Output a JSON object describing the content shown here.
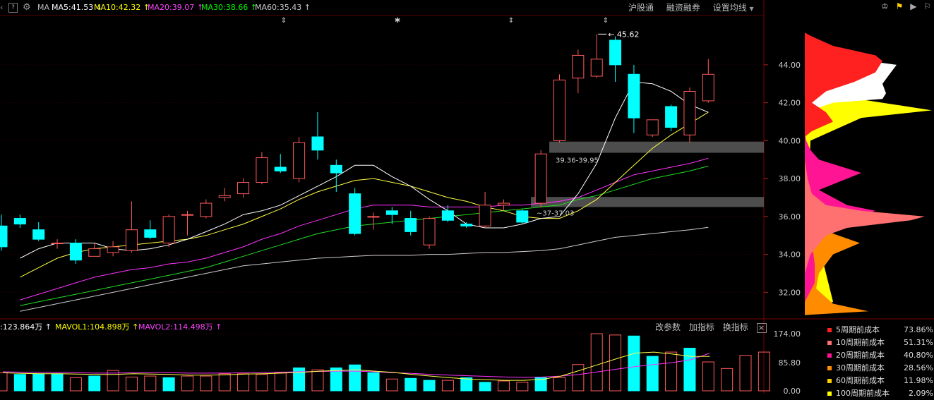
{
  "header": {
    "indicator": "MA",
    "ma": [
      {
        "label": "MA5:41.53",
        "arrow": "↓",
        "color": "#ffffff"
      },
      {
        "label": "MA10:42.32",
        "arrow": "↑",
        "color": "#ffff00"
      },
      {
        "label": "MA20:39.07",
        "arrow": "↑",
        "color": "#ff44ff"
      },
      {
        "label": "MA30:38.66",
        "arrow": "↑",
        "color": "#00ff00"
      },
      {
        "label": "MA60:35.43",
        "arrow": "↑",
        "color": "#cccccc"
      }
    ],
    "links": [
      "沪股通",
      "融资融券",
      "设置均线"
    ],
    "help_label": "?"
  },
  "volume_header": {
    "items": [
      {
        "label": ":123.864万",
        "arrow": "↑",
        "color": "#ffffff"
      },
      {
        "label": "MAVOL1:104.898万",
        "arrow": "↑",
        "color": "#ffff00"
      },
      {
        "label": "MAVOL2:114.498万",
        "arrow": "↑",
        "color": "#ff44ff"
      }
    ],
    "links": [
      "改参数",
      "加指标",
      "换指标"
    ],
    "close_label": "×"
  },
  "annotations": {
    "high_label": "45.62",
    "zone_upper_label": "39.36-39.95",
    "zone_lower_label": "~37-37.03"
  },
  "legend": [
    {
      "label": "5周期前成本",
      "pct": "73.86%",
      "color": "#ff2020"
    },
    {
      "label": "10周期前成本",
      "pct": "51.31%",
      "color": "#ff7070"
    },
    {
      "label": "20周期前成本",
      "pct": "40.80%",
      "color": "#ff1493"
    },
    {
      "label": "30周期前成本",
      "pct": "28.56%",
      "color": "#ff8c00"
    },
    {
      "label": "60周期前成本",
      "pct": "11.98%",
      "color": "#ffd000"
    },
    {
      "label": "100周期前成本",
      "pct": "2.09%",
      "color": "#ffff00"
    }
  ],
  "chart_data": {
    "type": "candlestick",
    "price_axis": {
      "ticks": [
        "44.00",
        "42.00",
        "40.00",
        "38.00",
        "36.00",
        "34.00",
        "32.00"
      ],
      "ylim": [
        30.6,
        46.6
      ]
    },
    "volume_axis": {
      "ticks": [
        "174.00",
        "85.80",
        "0.00"
      ],
      "ylim": [
        0,
        174
      ]
    },
    "up_color": "#ff5a5a",
    "down_color": "#00ffff",
    "candles": [
      {
        "o": 35.5,
        "h": 36.1,
        "l": 34.2,
        "c": 34.4
      },
      {
        "o": 35.9,
        "h": 36.1,
        "l": 35.4,
        "c": 35.6
      },
      {
        "o": 35.3,
        "h": 35.7,
        "l": 34.7,
        "c": 34.8
      },
      {
        "o": 34.6,
        "h": 34.8,
        "l": 34.3,
        "c": 34.6
      },
      {
        "o": 34.6,
        "h": 34.8,
        "l": 33.5,
        "c": 33.7
      },
      {
        "o": 33.9,
        "h": 34.6,
        "l": 33.9,
        "c": 34.3
      },
      {
        "o": 34.1,
        "h": 34.7,
        "l": 33.9,
        "c": 34.4
      },
      {
        "o": 34.2,
        "h": 36.8,
        "l": 34.1,
        "c": 35.3
      },
      {
        "o": 35.3,
        "h": 35.8,
        "l": 34.8,
        "c": 34.9
      },
      {
        "o": 34.6,
        "h": 36.1,
        "l": 34.4,
        "c": 36.0
      },
      {
        "o": 36.1,
        "h": 36.3,
        "l": 35.0,
        "c": 36.1
      },
      {
        "o": 36.0,
        "h": 36.9,
        "l": 35.9,
        "c": 36.7
      },
      {
        "o": 37.0,
        "h": 37.5,
        "l": 36.8,
        "c": 37.1
      },
      {
        "o": 37.2,
        "h": 38.0,
        "l": 37.0,
        "c": 37.8
      },
      {
        "o": 37.8,
        "h": 39.4,
        "l": 37.7,
        "c": 39.1
      },
      {
        "o": 38.6,
        "h": 39.3,
        "l": 38.3,
        "c": 38.4
      },
      {
        "o": 38.0,
        "h": 40.2,
        "l": 37.8,
        "c": 39.9
      },
      {
        "o": 40.2,
        "h": 41.5,
        "l": 39.0,
        "c": 39.5
      },
      {
        "o": 38.7,
        "h": 39.0,
        "l": 37.3,
        "c": 38.3
      },
      {
        "o": 37.2,
        "h": 37.5,
        "l": 35.0,
        "c": 35.1
      },
      {
        "o": 36.0,
        "h": 36.2,
        "l": 35.3,
        "c": 36.0
      },
      {
        "o": 36.3,
        "h": 36.5,
        "l": 35.6,
        "c": 36.1
      },
      {
        "o": 35.9,
        "h": 36.3,
        "l": 35.0,
        "c": 35.2
      },
      {
        "o": 34.5,
        "h": 36.0,
        "l": 34.3,
        "c": 35.9
      },
      {
        "o": 36.3,
        "h": 36.6,
        "l": 35.7,
        "c": 35.8
      },
      {
        "o": 35.6,
        "h": 35.7,
        "l": 35.4,
        "c": 35.5
      },
      {
        "o": 35.5,
        "h": 37.3,
        "l": 35.4,
        "c": 36.6
      },
      {
        "o": 36.6,
        "h": 36.9,
        "l": 36.3,
        "c": 36.7
      },
      {
        "o": 36.3,
        "h": 36.4,
        "l": 35.6,
        "c": 35.7
      },
      {
        "o": 36.7,
        "h": 39.5,
        "l": 36.5,
        "c": 39.3
      },
      {
        "o": 40.0,
        "h": 43.5,
        "l": 39.9,
        "c": 43.2
      },
      {
        "o": 43.3,
        "h": 44.8,
        "l": 42.5,
        "c": 44.5
      },
      {
        "o": 43.4,
        "h": 45.62,
        "l": 43.3,
        "c": 44.3
      },
      {
        "o": 45.3,
        "h": 45.5,
        "l": 43.1,
        "c": 44.0
      },
      {
        "o": 43.5,
        "h": 44.0,
        "l": 40.4,
        "c": 41.2
      },
      {
        "o": 40.3,
        "h": 41.1,
        "l": 40.2,
        "c": 41.1
      },
      {
        "o": 41.8,
        "h": 41.9,
        "l": 40.5,
        "c": 40.7
      },
      {
        "o": 40.3,
        "h": 42.8,
        "l": 39.9,
        "c": 42.6
      },
      {
        "o": 42.1,
        "h": 44.3,
        "l": 42.0,
        "c": 43.5
      }
    ],
    "volumes": [
      70,
      55,
      50,
      52,
      52,
      40,
      45,
      62,
      42,
      45,
      40,
      45,
      45,
      52,
      52,
      50,
      55,
      70,
      64,
      70,
      79,
      55,
      36,
      38,
      32,
      32,
      40,
      26,
      30,
      26,
      40,
      40,
      80,
      174,
      170,
      167,
      105,
      118,
      130,
      88,
      68,
      108,
      118
    ],
    "ma5": [
      33.8,
      34.3,
      34.6,
      34.6,
      34.6,
      34.3,
      34.2,
      34.3,
      34.5,
      34.8,
      35.2,
      35.6,
      36.1,
      36.3,
      36.6,
      37.1,
      37.6,
      38.1,
      38.7,
      38.7,
      38.1,
      37.6,
      36.9,
      36.3,
      35.6,
      35.4,
      35.4,
      35.6,
      35.9,
      36.0,
      37.2,
      38.8,
      41.2,
      43.1,
      43.0,
      42.6,
      41.9,
      41.5
    ],
    "ma10": [
      32.8,
      33.3,
      33.8,
      34.1,
      34.3,
      34.4,
      34.5,
      34.6,
      34.7,
      34.8,
      35.0,
      35.3,
      35.6,
      36.0,
      36.4,
      36.9,
      37.3,
      37.6,
      37.9,
      38.0,
      37.8,
      37.6,
      37.3,
      37.0,
      36.8,
      36.5,
      36.3,
      36.0,
      35.9,
      35.9,
      36.3,
      36.9,
      37.8,
      38.7,
      39.6,
      40.3,
      40.9,
      41.5
    ],
    "ma20": [
      31.6,
      31.9,
      32.2,
      32.5,
      32.8,
      33.0,
      33.2,
      33.3,
      33.5,
      33.6,
      33.8,
      34.1,
      34.4,
      34.8,
      35.1,
      35.5,
      35.8,
      36.1,
      36.4,
      36.6,
      36.6,
      36.6,
      36.5,
      36.5,
      36.5,
      36.5,
      36.6,
      36.6,
      36.7,
      36.8,
      37.0,
      37.4,
      37.8,
      38.2,
      38.4,
      38.6,
      38.8,
      39.07
    ],
    "ma30": [
      31.3,
      31.5,
      31.7,
      31.9,
      32.1,
      32.3,
      32.5,
      32.7,
      32.9,
      33.1,
      33.3,
      33.6,
      33.9,
      34.2,
      34.5,
      34.8,
      35.1,
      35.3,
      35.5,
      35.6,
      35.7,
      35.8,
      35.9,
      36.0,
      36.1,
      36.2,
      36.3,
      36.4,
      36.5,
      36.6,
      36.9,
      37.1,
      37.4,
      37.7,
      38.0,
      38.2,
      38.4,
      38.66
    ],
    "ma60": [
      31.0,
      31.2,
      31.4,
      31.6,
      31.8,
      32.0,
      32.2,
      32.4,
      32.6,
      32.8,
      33.0,
      33.2,
      33.4,
      33.5,
      33.6,
      33.7,
      33.8,
      33.85,
      33.9,
      33.95,
      33.95,
      33.95,
      34.0,
      34.0,
      34.05,
      34.1,
      34.1,
      34.15,
      34.2,
      34.3,
      34.5,
      34.7,
      34.9,
      35.0,
      35.1,
      35.2,
      35.3,
      35.43
    ],
    "mavol1": [
      55,
      53,
      52,
      52,
      51,
      50,
      50,
      52,
      51,
      50,
      48,
      48,
      49,
      51,
      52,
      54,
      56,
      60,
      62,
      64,
      60,
      56,
      50,
      45,
      40,
      36,
      34,
      32,
      32,
      35,
      45,
      62,
      80,
      98,
      115,
      118,
      112,
      105,
      104.9
    ],
    "mavol2": [
      58,
      57,
      57,
      56,
      55,
      54,
      54,
      55,
      55,
      55,
      54,
      54,
      54,
      55,
      56,
      57,
      58,
      59,
      60,
      60,
      58,
      55,
      53,
      50,
      48,
      46,
      44,
      42,
      41,
      42,
      45,
      50,
      58,
      66,
      74,
      80,
      86,
      95,
      114.5
    ],
    "zones": [
      {
        "from": 39.36,
        "to": 39.95
      },
      {
        "from": 36.5,
        "to": 37.03
      }
    ]
  }
}
